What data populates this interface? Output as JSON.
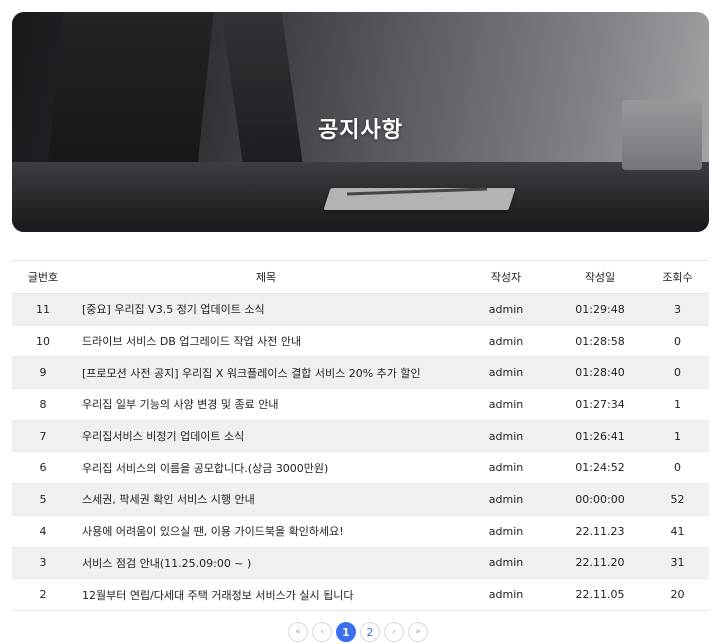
{
  "hero": {
    "title": "공지사항"
  },
  "table": {
    "headers": {
      "no": "글번호",
      "title": "제목",
      "writer": "작성자",
      "date": "작성일",
      "views": "조회수"
    },
    "rows": [
      {
        "no": "11",
        "title": "[중요] 우리집 V3.5 정기 업데이트 소식",
        "writer": "admin",
        "date": "01:29:48",
        "views": "3"
      },
      {
        "no": "10",
        "title": "드라이브 서비스 DB 업그레이드 작업 사전 안내",
        "writer": "admin",
        "date": "01:28:58",
        "views": "0"
      },
      {
        "no": "9",
        "title": "[프로모션 사전 공지] 우리집 X 워크플레이스 결합 서비스 20% 추가 할인",
        "writer": "admin",
        "date": "01:28:40",
        "views": "0"
      },
      {
        "no": "8",
        "title": "우리집 일부 기능의 사양 변경 및 종료 안내",
        "writer": "admin",
        "date": "01:27:34",
        "views": "1"
      },
      {
        "no": "7",
        "title": "우리집서비스 비정기 업데이트 소식",
        "writer": "admin",
        "date": "01:26:41",
        "views": "1"
      },
      {
        "no": "6",
        "title": "우리집 서비스의 이름을 공모합니다.(상금 3000만원)",
        "writer": "admin",
        "date": "01:24:52",
        "views": "0"
      },
      {
        "no": "5",
        "title": "스세권, 팍세권 확인 서비스 시행 안내",
        "writer": "admin",
        "date": "00:00:00",
        "views": "52"
      },
      {
        "no": "4",
        "title": "사용에 어려움이 있으실 땐, 이용 가이드북을 확인하세요!",
        "writer": "admin",
        "date": "22.11.23",
        "views": "41"
      },
      {
        "no": "3",
        "title": "서비스 점검 안내(11.25.09:00 ~ )",
        "writer": "admin",
        "date": "22.11.20",
        "views": "31"
      },
      {
        "no": "2",
        "title": "12월부터 연립/다세대 주택 거래정보 서비스가 실시 됩니다",
        "writer": "admin",
        "date": "22.11.05",
        "views": "20"
      }
    ]
  },
  "pagination": {
    "first": "«",
    "prev": "‹",
    "next": "›",
    "last": "»",
    "pages": [
      "1",
      "2"
    ],
    "current": "1",
    "active_color": "#3b6ff0"
  }
}
